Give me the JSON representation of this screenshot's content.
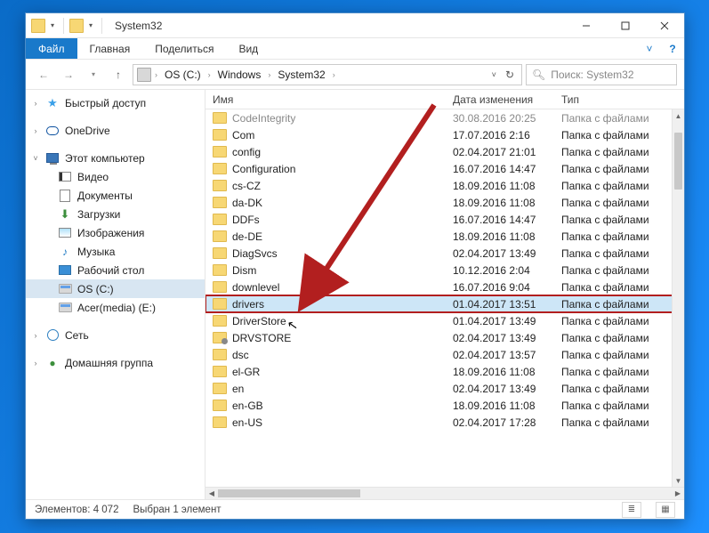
{
  "window": {
    "title": "System32",
    "tabs": {
      "file": "Файл",
      "home": "Главная",
      "share": "Поделиться",
      "view": "Вид"
    }
  },
  "breadcrumbs": [
    "OS (C:)",
    "Windows",
    "System32"
  ],
  "search": {
    "placeholder": "Поиск: System32"
  },
  "columns": {
    "name": "Имя",
    "date": "Дата изменения",
    "type": "Тип"
  },
  "folder_type": "Папка с файлами",
  "sidebar": {
    "quick": "Быстрый доступ",
    "onedrive": "OneDrive",
    "thispc": "Этот компьютер",
    "video": "Видео",
    "docs": "Документы",
    "down": "Загрузки",
    "pics": "Изображения",
    "music": "Музыка",
    "desk": "Рабочий стол",
    "osc": "OS (C:)",
    "acer": "Acer(media) (E:)",
    "network": "Сеть",
    "homegrp": "Домашняя группа"
  },
  "files": [
    {
      "name": "CodeIntegrity",
      "date": "30.08.2016 20:25",
      "dim": true
    },
    {
      "name": "Com",
      "date": "17.07.2016 2:16"
    },
    {
      "name": "config",
      "date": "02.04.2017 21:01"
    },
    {
      "name": "Configuration",
      "date": "16.07.2016 14:47"
    },
    {
      "name": "cs-CZ",
      "date": "18.09.2016 11:08"
    },
    {
      "name": "da-DK",
      "date": "18.09.2016 11:08"
    },
    {
      "name": "DDFs",
      "date": "16.07.2016 14:47"
    },
    {
      "name": "de-DE",
      "date": "18.09.2016 11:08"
    },
    {
      "name": "DiagSvcs",
      "date": "02.04.2017 13:49"
    },
    {
      "name": "Dism",
      "date": "10.12.2016 2:04"
    },
    {
      "name": "downlevel",
      "date": "16.07.2016 9:04"
    },
    {
      "name": "drivers",
      "date": "01.04.2017 13:51",
      "selected": true
    },
    {
      "name": "DriverStore",
      "date": "01.04.2017 13:49"
    },
    {
      "name": "DRVSTORE",
      "date": "02.04.2017 13:49",
      "cfg": true
    },
    {
      "name": "dsc",
      "date": "02.04.2017 13:57"
    },
    {
      "name": "el-GR",
      "date": "18.09.2016 11:08"
    },
    {
      "name": "en",
      "date": "02.04.2017 13:49"
    },
    {
      "name": "en-GB",
      "date": "18.09.2016 11:08"
    },
    {
      "name": "en-US",
      "date": "02.04.2017 17:28"
    }
  ],
  "status": {
    "count_label": "Элементов:",
    "count_value": "4 072",
    "sel_label": "Выбран 1 элемент"
  }
}
